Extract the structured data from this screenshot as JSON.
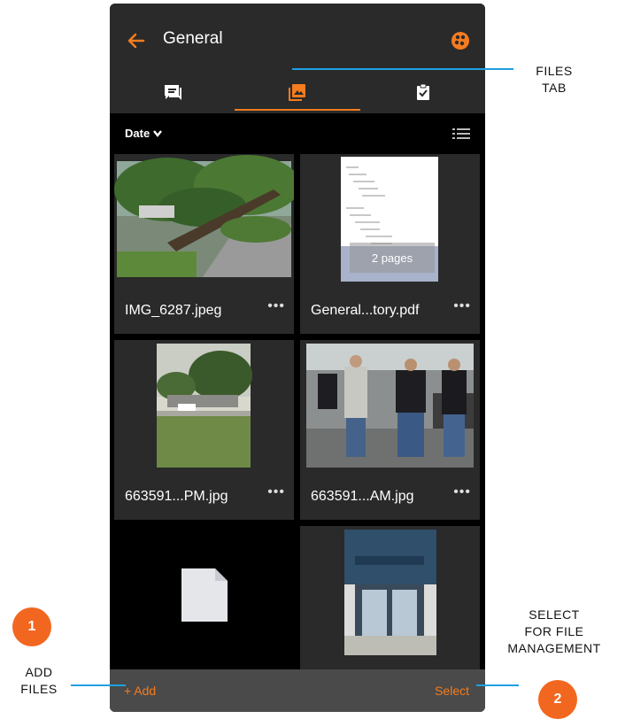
{
  "header": {
    "title": "General"
  },
  "tabs": [
    {
      "id": "chat",
      "icon": "chat-icon",
      "active": false
    },
    {
      "id": "files",
      "icon": "photo-icon",
      "active": true
    },
    {
      "id": "tasks",
      "icon": "task-icon",
      "active": false
    }
  ],
  "sort": {
    "label": "Date"
  },
  "files": [
    {
      "name": "IMG_6287.jpeg",
      "more": "•••"
    },
    {
      "name": "General...tory.pdf",
      "more": "•••",
      "pages": "2 pages"
    },
    {
      "name": "663591...PM.jpg",
      "more": "•••"
    },
    {
      "name": "663591...AM.jpg",
      "more": "•••"
    },
    {
      "name": "",
      "more": ""
    },
    {
      "name": "",
      "more": ""
    }
  ],
  "bottom": {
    "add_label": "+ Add",
    "select_label": "Select"
  },
  "annotations": {
    "files_tab": "FILES\nTAB",
    "add_files": "ADD\nFILES",
    "select_files": "SELECT\nFOR FILE\nMANAGEMENT",
    "badge1": "1",
    "badge2": "2"
  },
  "colors": {
    "accent": "#f57c1f",
    "annotation_line": "#1ea0e0",
    "badge": "#f2671f"
  }
}
